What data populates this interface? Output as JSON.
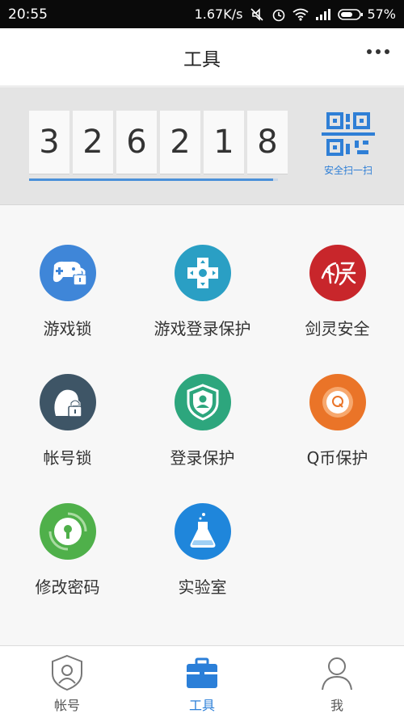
{
  "status_bar": {
    "time": "20:55",
    "speed": "1.67K/s",
    "battery": "57%"
  },
  "header": {
    "title": "工具"
  },
  "token": {
    "digits": [
      "3",
      "2",
      "6",
      "2",
      "1",
      "8"
    ],
    "progress_fraction": 0.98,
    "scan_label": "安全扫一扫"
  },
  "tools": [
    {
      "label": "游戏锁",
      "icon": "gamepad-lock-icon",
      "color": "#3f86d8"
    },
    {
      "label": "游戏登录保护",
      "icon": "game-cross-icon",
      "color": "#2a9fc4"
    },
    {
      "label": "剑灵安全",
      "icon": "jianling-logo-icon",
      "color": "#c8262b"
    },
    {
      "label": "帐号锁",
      "icon": "profile-lock-icon",
      "color": "#3e5566"
    },
    {
      "label": "登录保护",
      "icon": "shield-user-icon",
      "color": "#2da67d"
    },
    {
      "label": "Q币保护",
      "icon": "qcoin-icon",
      "color": "#ea7428"
    },
    {
      "label": "修改密码",
      "icon": "keyhole-icon",
      "color": "#4fb04a"
    },
    {
      "label": "实验室",
      "icon": "flask-icon",
      "color": "#1f86db"
    }
  ],
  "tabs": [
    {
      "label": "帐号",
      "icon": "account-shield-icon"
    },
    {
      "label": "工具",
      "icon": "toolbox-icon",
      "active": true
    },
    {
      "label": "我",
      "icon": "person-icon"
    }
  ],
  "colors": {
    "accent": "#2b7fd8",
    "status_bar": "#0a0a0a"
  }
}
